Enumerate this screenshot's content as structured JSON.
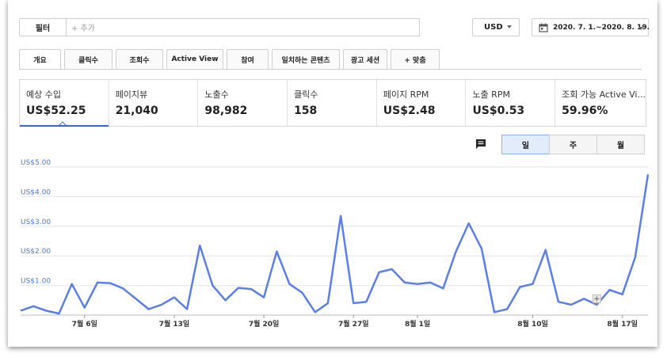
{
  "filter": {
    "label": "필터",
    "placeholder": "+ 추가"
  },
  "currency": {
    "value": "USD"
  },
  "date_range": {
    "value": "2020. 7. 1.~2020. 8. 19."
  },
  "tabs": [
    {
      "label": "개요"
    },
    {
      "label": "클릭수"
    },
    {
      "label": "조회수"
    },
    {
      "label": "Active View"
    },
    {
      "label": "참여"
    },
    {
      "label": "일치하는 콘텐츠"
    },
    {
      "label": "광고 세션"
    },
    {
      "label": "+ 맞춤"
    }
  ],
  "metrics": [
    {
      "label": "예상 수입",
      "value": "US$52.25"
    },
    {
      "label": "페이지뷰",
      "value": "21,040"
    },
    {
      "label": "노출수",
      "value": "98,982"
    },
    {
      "label": "클릭수",
      "value": "158"
    },
    {
      "label": "페이지 RPM",
      "value": "US$2.48"
    },
    {
      "label": "노출 RPM",
      "value": "US$0.53"
    },
    {
      "label": "조회 가능 Active Vi...",
      "value": "59.96%"
    }
  ],
  "granularity": [
    {
      "label": "일"
    },
    {
      "label": "주"
    },
    {
      "label": "월"
    }
  ],
  "colors": {
    "accent": "#3367d6",
    "line": "#5b7fe6",
    "axis_label": "#4a7bd8"
  },
  "chart_data": {
    "type": "line",
    "ylim": [
      0,
      5
    ],
    "yticks": [
      "US$1.00",
      "US$2.00",
      "US$3.00",
      "US$4.00",
      "US$5.00"
    ],
    "x_labels": [
      "7월 6일",
      "7월 13일",
      "7월 20일",
      "7월 27일",
      "8월 1일",
      "8월 10일",
      "8월 17일"
    ],
    "series": [
      {
        "values": [
          0.15,
          0.3,
          0.15,
          0.05,
          1.05,
          0.25,
          1.1,
          1.08,
          0.9,
          0.55,
          0.2,
          0.35,
          0.6,
          0.2,
          2.35,
          1.0,
          0.5,
          0.92,
          0.88,
          0.6,
          2.15,
          1.05,
          0.75,
          0.1,
          0.4,
          3.35,
          0.4,
          0.45,
          1.45,
          1.55,
          1.1,
          1.05,
          1.1,
          0.9,
          2.15,
          3.1,
          2.25,
          0.1,
          0.2,
          0.95,
          1.05,
          2.2,
          0.45,
          0.35,
          0.55,
          0.35,
          0.85,
          0.7,
          1.95,
          4.75
        ]
      }
    ]
  }
}
